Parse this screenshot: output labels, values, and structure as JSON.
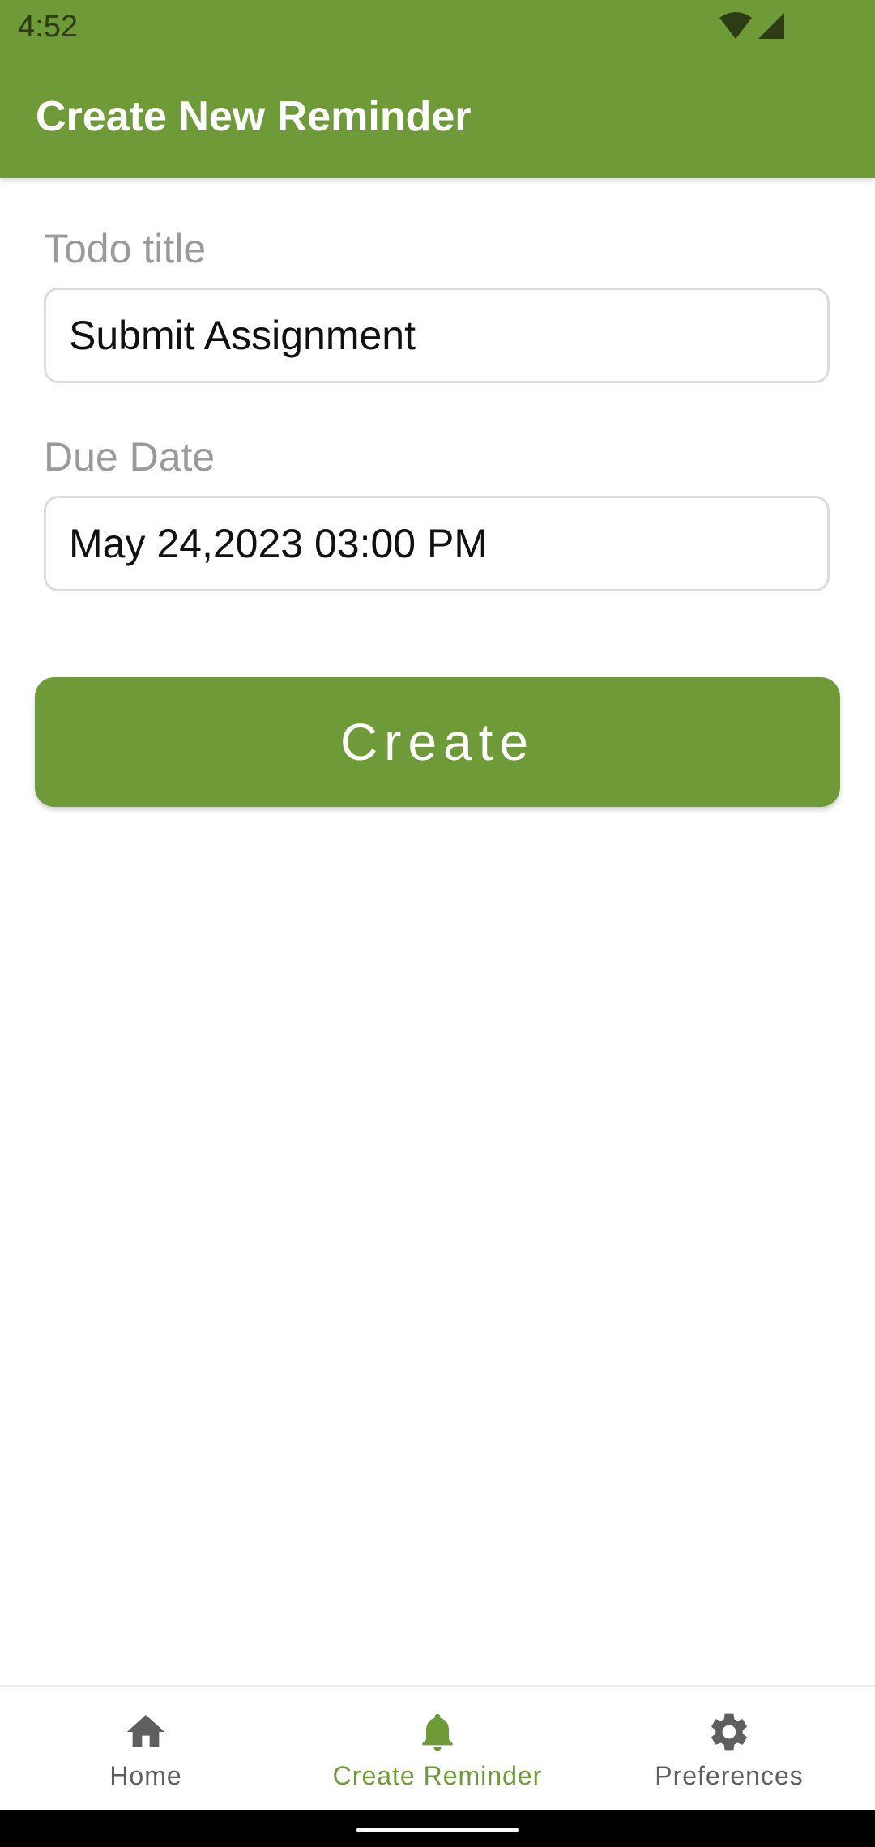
{
  "status_bar": {
    "time": "4:52",
    "icons": [
      "wifi-icon",
      "cellular-signal-icon"
    ]
  },
  "app_bar": {
    "title": "Create New Reminder"
  },
  "form": {
    "todo_title_label": "Todo title",
    "todo_title_value": "Submit Assignment",
    "due_date_label": "Due Date",
    "due_date_value": "May 24,2023 03:00 PM",
    "create_label": "Create"
  },
  "bottom_nav": {
    "items": [
      {
        "label": "Home",
        "icon": "home-icon",
        "active": false
      },
      {
        "label": "Create Reminder",
        "icon": "bell-icon",
        "active": true
      },
      {
        "label": "Preferences",
        "icon": "gear-icon",
        "active": false
      }
    ]
  },
  "colors": {
    "primary": "#6f9a38",
    "inactive_nav": "#5f5f5f",
    "label_gray": "#9a9a9a"
  }
}
